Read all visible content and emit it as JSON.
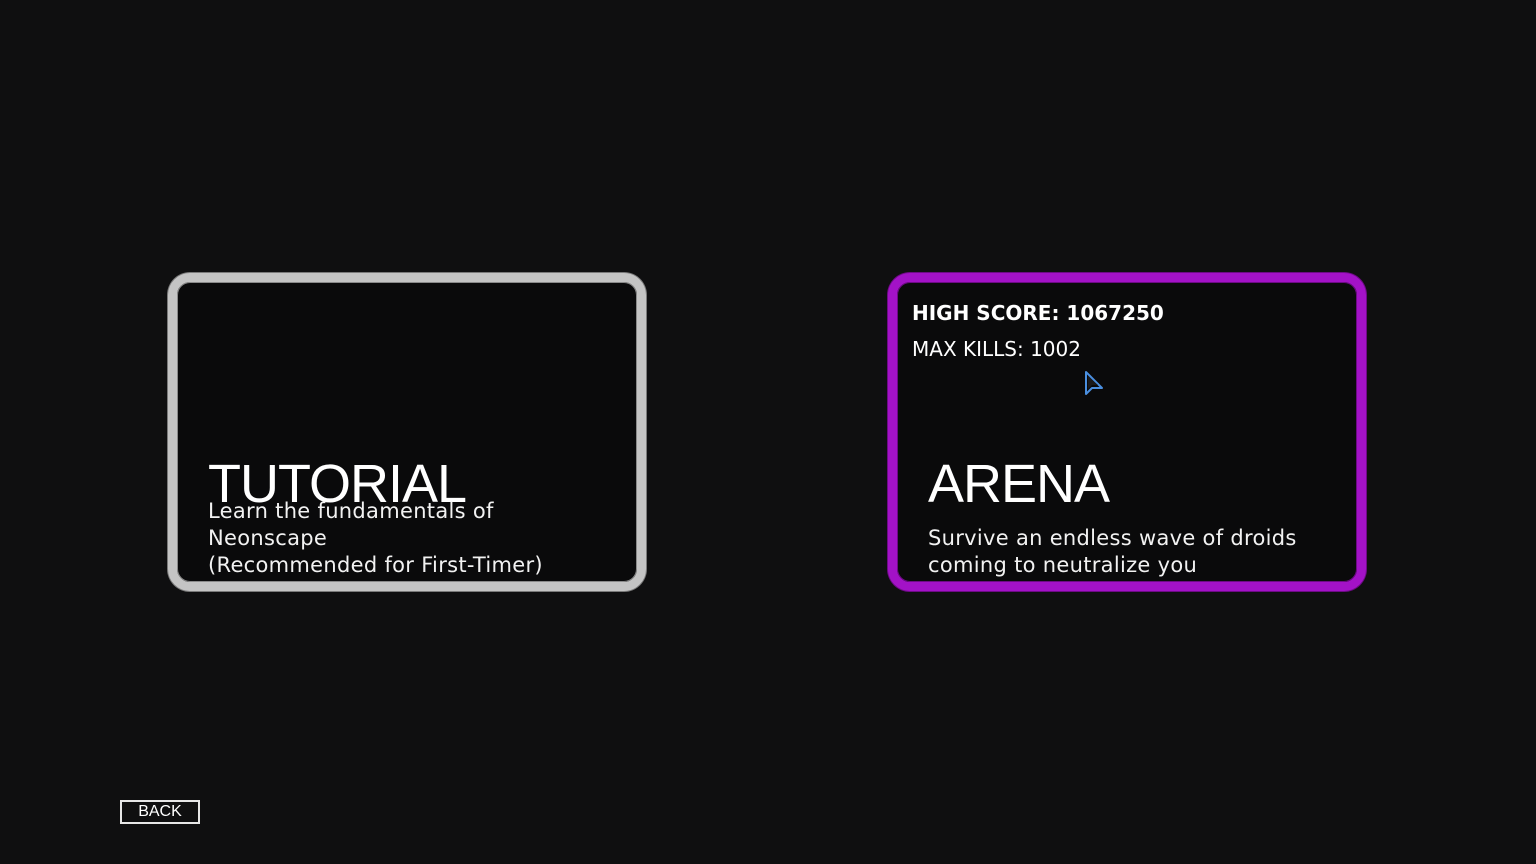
{
  "tutorial": {
    "title": "TUTORIAL",
    "description_lines": [
      "Learn the fundamentals of",
      "Neonscape",
      "(Recommended for First-Timer)"
    ]
  },
  "arena": {
    "high_score_label": "HIGH SCORE: 1067250",
    "max_kills_label": "MAX KILLS: 1002",
    "title": "ARENA",
    "description_lines": [
      "Survive an endless wave of droids",
      "coming to neutralize you"
    ]
  },
  "back_label": "BACK",
  "colors": {
    "background": "#0f0f10",
    "tutorial_border": "#c4c4c4",
    "arena_border": "#a312c7",
    "cursor": "#4a8fe0"
  },
  "icons": {
    "cursor": "mouse-pointer-icon"
  }
}
